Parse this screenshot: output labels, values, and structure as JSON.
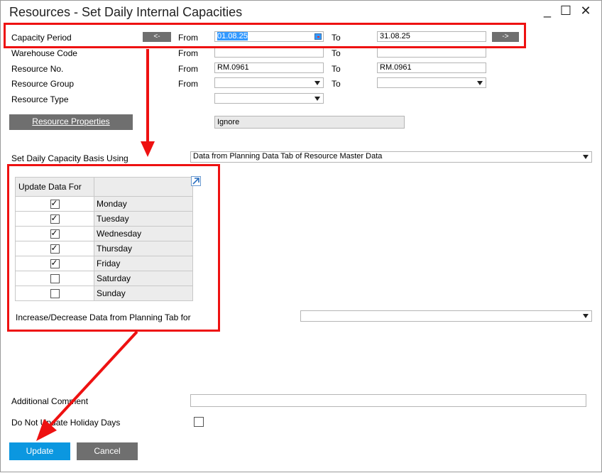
{
  "window": {
    "title": "Resources - Set Daily Internal Capacities",
    "minimize": "_",
    "maximize": "☐",
    "close": "✕"
  },
  "labels": {
    "capacity_period": "Capacity Period",
    "warehouse_code": "Warehouse Code",
    "resource_no": "Resource No.",
    "resource_group": "Resource Group",
    "resource_type": "Resource Type",
    "from": "From",
    "to": "To",
    "set_daily_basis": "Set Daily Capacity Basis Using",
    "increase_decrease": "Increase/Decrease Data from Planning Tab for",
    "additional_comment": "Additional Comment",
    "do_not_update_holiday": "Do Not Update Holiday Days"
  },
  "fields": {
    "capacity_from": "01.08.25",
    "capacity_to": "31.08.25",
    "warehouse_from": "",
    "warehouse_to": "",
    "resource_from": "RM.0961",
    "resource_to": "RM.0961",
    "group_from": "",
    "group_to": "",
    "resource_type": "",
    "properties_value": "Ignore",
    "daily_basis": "Data from Planning Data Tab of Resource Master Data",
    "increase_decrease": "",
    "additional_comment": ""
  },
  "buttons": {
    "prev": "<-",
    "next": "->",
    "resource_properties": "Resource Properties",
    "update": "Update",
    "cancel": "Cancel"
  },
  "table": {
    "header": "Update Data For",
    "rows": [
      {
        "day": "Monday",
        "checked": true
      },
      {
        "day": "Tuesday",
        "checked": true
      },
      {
        "day": "Wednesday",
        "checked": true
      },
      {
        "day": "Thursday",
        "checked": true
      },
      {
        "day": "Friday",
        "checked": true
      },
      {
        "day": "Saturday",
        "checked": false
      },
      {
        "day": "Sunday",
        "checked": false
      }
    ]
  },
  "holiday_checked": false,
  "colors": {
    "highlight": "#e11111",
    "primary": "#0b97e0",
    "button_gray": "#6f6f6f"
  }
}
